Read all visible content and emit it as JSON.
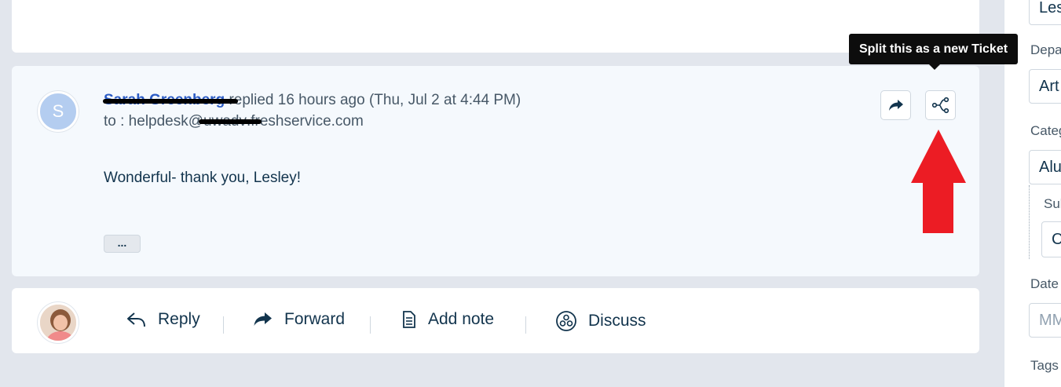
{
  "conversation": {
    "avatar_initial": "S",
    "sender_name": "Sarah Greenberg",
    "replied_text": " replied 16 hours ago (Thu, Jul 2 at 4:44 PM)",
    "to_prefix": "to : helpdesk@",
    "to_redacted": "uwadv",
    "to_suffix": ".freshservice.com",
    "body": "Wonderful- thank you, Lesley!",
    "more_label": "...",
    "tooltip": "Split this as a new Ticket"
  },
  "actions": {
    "reply": "Reply",
    "forward": "Forward",
    "add_note": "Add note",
    "discuss": "Discuss"
  },
  "sidebar": {
    "agent_value": "Les",
    "department_label": "Depa",
    "department_value": "Art",
    "category_label": "Categ",
    "category_value": "Alu",
    "subcategory_label": "Sul",
    "subcategory_value": "C",
    "date_label": "Date",
    "date_placeholder": "MM",
    "tags_label": "Tags"
  },
  "colors": {
    "accent": "#2c5cc5",
    "highlight_arrow": "#ec1c24",
    "card_background": "#f5f9fd",
    "page_background": "#e2e6ed"
  }
}
